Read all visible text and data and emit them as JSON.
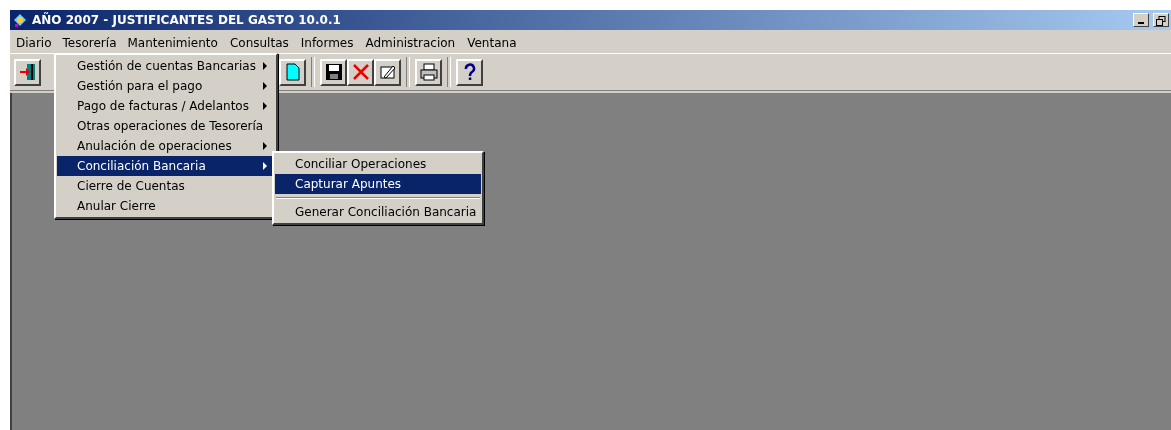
{
  "window": {
    "title": "AÑO 2007 - JUSTIFICANTES DEL GASTO 10.0.1"
  },
  "menubar": [
    {
      "label": "Diario",
      "selected": false
    },
    {
      "label": "Tesorería",
      "selected": true
    },
    {
      "label": "Mantenimiento",
      "selected": false
    },
    {
      "label": "Consultas",
      "selected": false
    },
    {
      "label": "Informes",
      "selected": false
    },
    {
      "label": "Administracion",
      "selected": false
    },
    {
      "label": "Ventana",
      "selected": false
    }
  ],
  "menu": [
    {
      "label": "Gestión de cuentas Bancarias",
      "submenu": true,
      "selected": false
    },
    {
      "label": "Gestión para el pago",
      "submenu": true,
      "selected": false
    },
    {
      "label": "Pago de facturas / Adelantos",
      "submenu": true,
      "selected": false
    },
    {
      "label": "Otras operaciones de Tesorería",
      "submenu": false,
      "selected": false
    },
    {
      "label": "Anulación de operaciones",
      "submenu": true,
      "selected": false
    },
    {
      "label": "Conciliación Bancaria",
      "submenu": true,
      "selected": true
    },
    {
      "label": "Cierre de Cuentas",
      "submenu": false,
      "selected": false
    },
    {
      "label": "Anular Cierre",
      "submenu": false,
      "selected": false
    }
  ],
  "submenu": [
    {
      "kind": "item",
      "label": "Conciliar Operaciones",
      "selected": false
    },
    {
      "kind": "item",
      "label": "Capturar Apuntes",
      "selected": true
    },
    {
      "kind": "separator"
    },
    {
      "kind": "item",
      "label": "Generar Conciliación Bancaria",
      "selected": false
    }
  ],
  "toolbar": [
    {
      "kind": "exit"
    },
    {
      "kind": "gap"
    },
    {
      "kind": "new"
    },
    {
      "kind": "sep"
    },
    {
      "kind": "save"
    },
    {
      "kind": "delete"
    },
    {
      "kind": "edit"
    },
    {
      "kind": "sep"
    },
    {
      "kind": "print"
    },
    {
      "kind": "sep"
    },
    {
      "kind": "help"
    }
  ]
}
